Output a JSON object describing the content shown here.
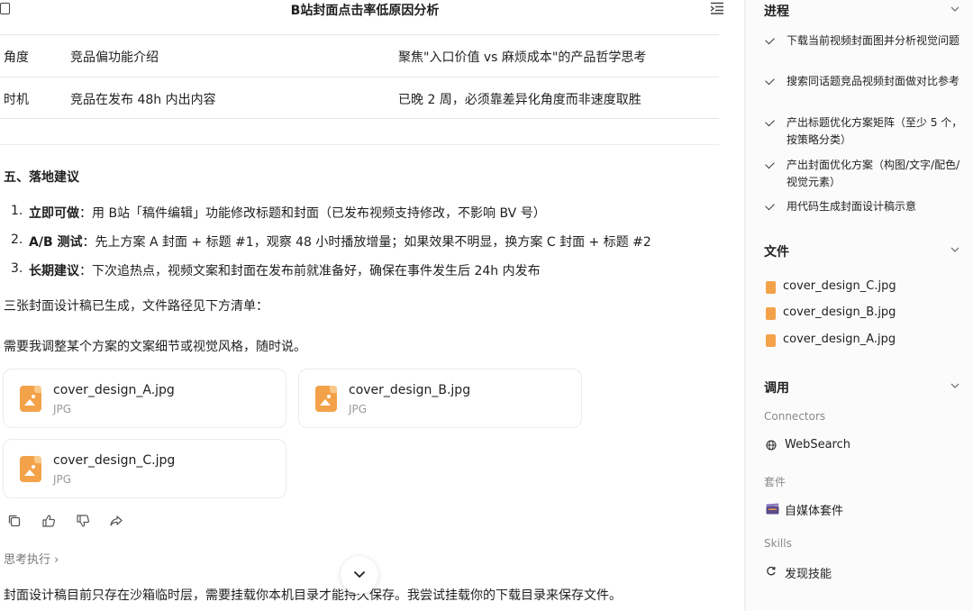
{
  "header": {
    "title": "B站封面点击率低原因分析"
  },
  "table": {
    "rows": [
      [
        "角度",
        "竞品偏功能介绍",
        "聚焦\"入口价值 vs 麻烦成本\"的产品哲学思考"
      ],
      [
        "时机",
        "竞品在发布 48h 内出内容",
        "已晚 2 周，必须靠差异化角度而非速度取胜"
      ]
    ]
  },
  "section": {
    "title": "五、落地建议",
    "items": [
      {
        "num": "1.",
        "label": "立即可做",
        "text": "：用 B站「稿件编辑」功能修改标题和封面（已发布视频支持修改，不影响 BV 号）"
      },
      {
        "num": "2.",
        "label": "A/B 测试",
        "text": "：先上方案 A 封面 + 标题 #1，观察 48 小时播放增量；如果效果不明显，换方案 C 封面 + 标题 #2"
      },
      {
        "num": "3.",
        "label": "长期建议",
        "text": "：下次追热点，视频文案和封面在发布前就准备好，确保在事件发生后 24h 内发布"
      }
    ]
  },
  "paragraphs": {
    "p1": "三张封面设计稿已生成，文件路径见下方清单：",
    "p2": "需要我调整某个方案的文案细节或视觉风格，随时说。"
  },
  "cards": [
    {
      "name": "cover_design_A.jpg",
      "type": "JPG"
    },
    {
      "name": "cover_design_B.jpg",
      "type": "JPG"
    },
    {
      "name": "cover_design_C.jpg",
      "type": "JPG"
    }
  ],
  "thinking": {
    "label": "思考执行 ›"
  },
  "bottom": {
    "text": "封面设计稿目前只存在沙箱临时层，需要挂载你本机目录才能持久保存。我尝试挂载你的下载目录来保存文件。"
  },
  "sidebar": {
    "progress": {
      "title": "进程",
      "tasks": [
        "下载当前视频封面图并分析视觉问题",
        "搜索同话题竞品视频封面做对比参考",
        "产出标题优化方案矩阵（至少 5 个，按策略分类）",
        "产出封面优化方案（构图/文字/配色/视觉元素）",
        "用代码生成封面设计稿示意"
      ]
    },
    "files": {
      "title": "文件",
      "items": [
        "cover_design_C.jpg",
        "cover_design_B.jpg",
        "cover_design_A.jpg"
      ]
    },
    "calls": {
      "title": "调用",
      "connectors_label": "Connectors",
      "connector": "WebSearch",
      "kits_label": "套件",
      "kit": "自媒体套件",
      "skills_label": "Skills",
      "skill": "发现技能"
    }
  },
  "colors": {
    "file_icon": "#f4a24a",
    "accent_text": "#1f1f1f",
    "muted": "#8a8a8a"
  }
}
